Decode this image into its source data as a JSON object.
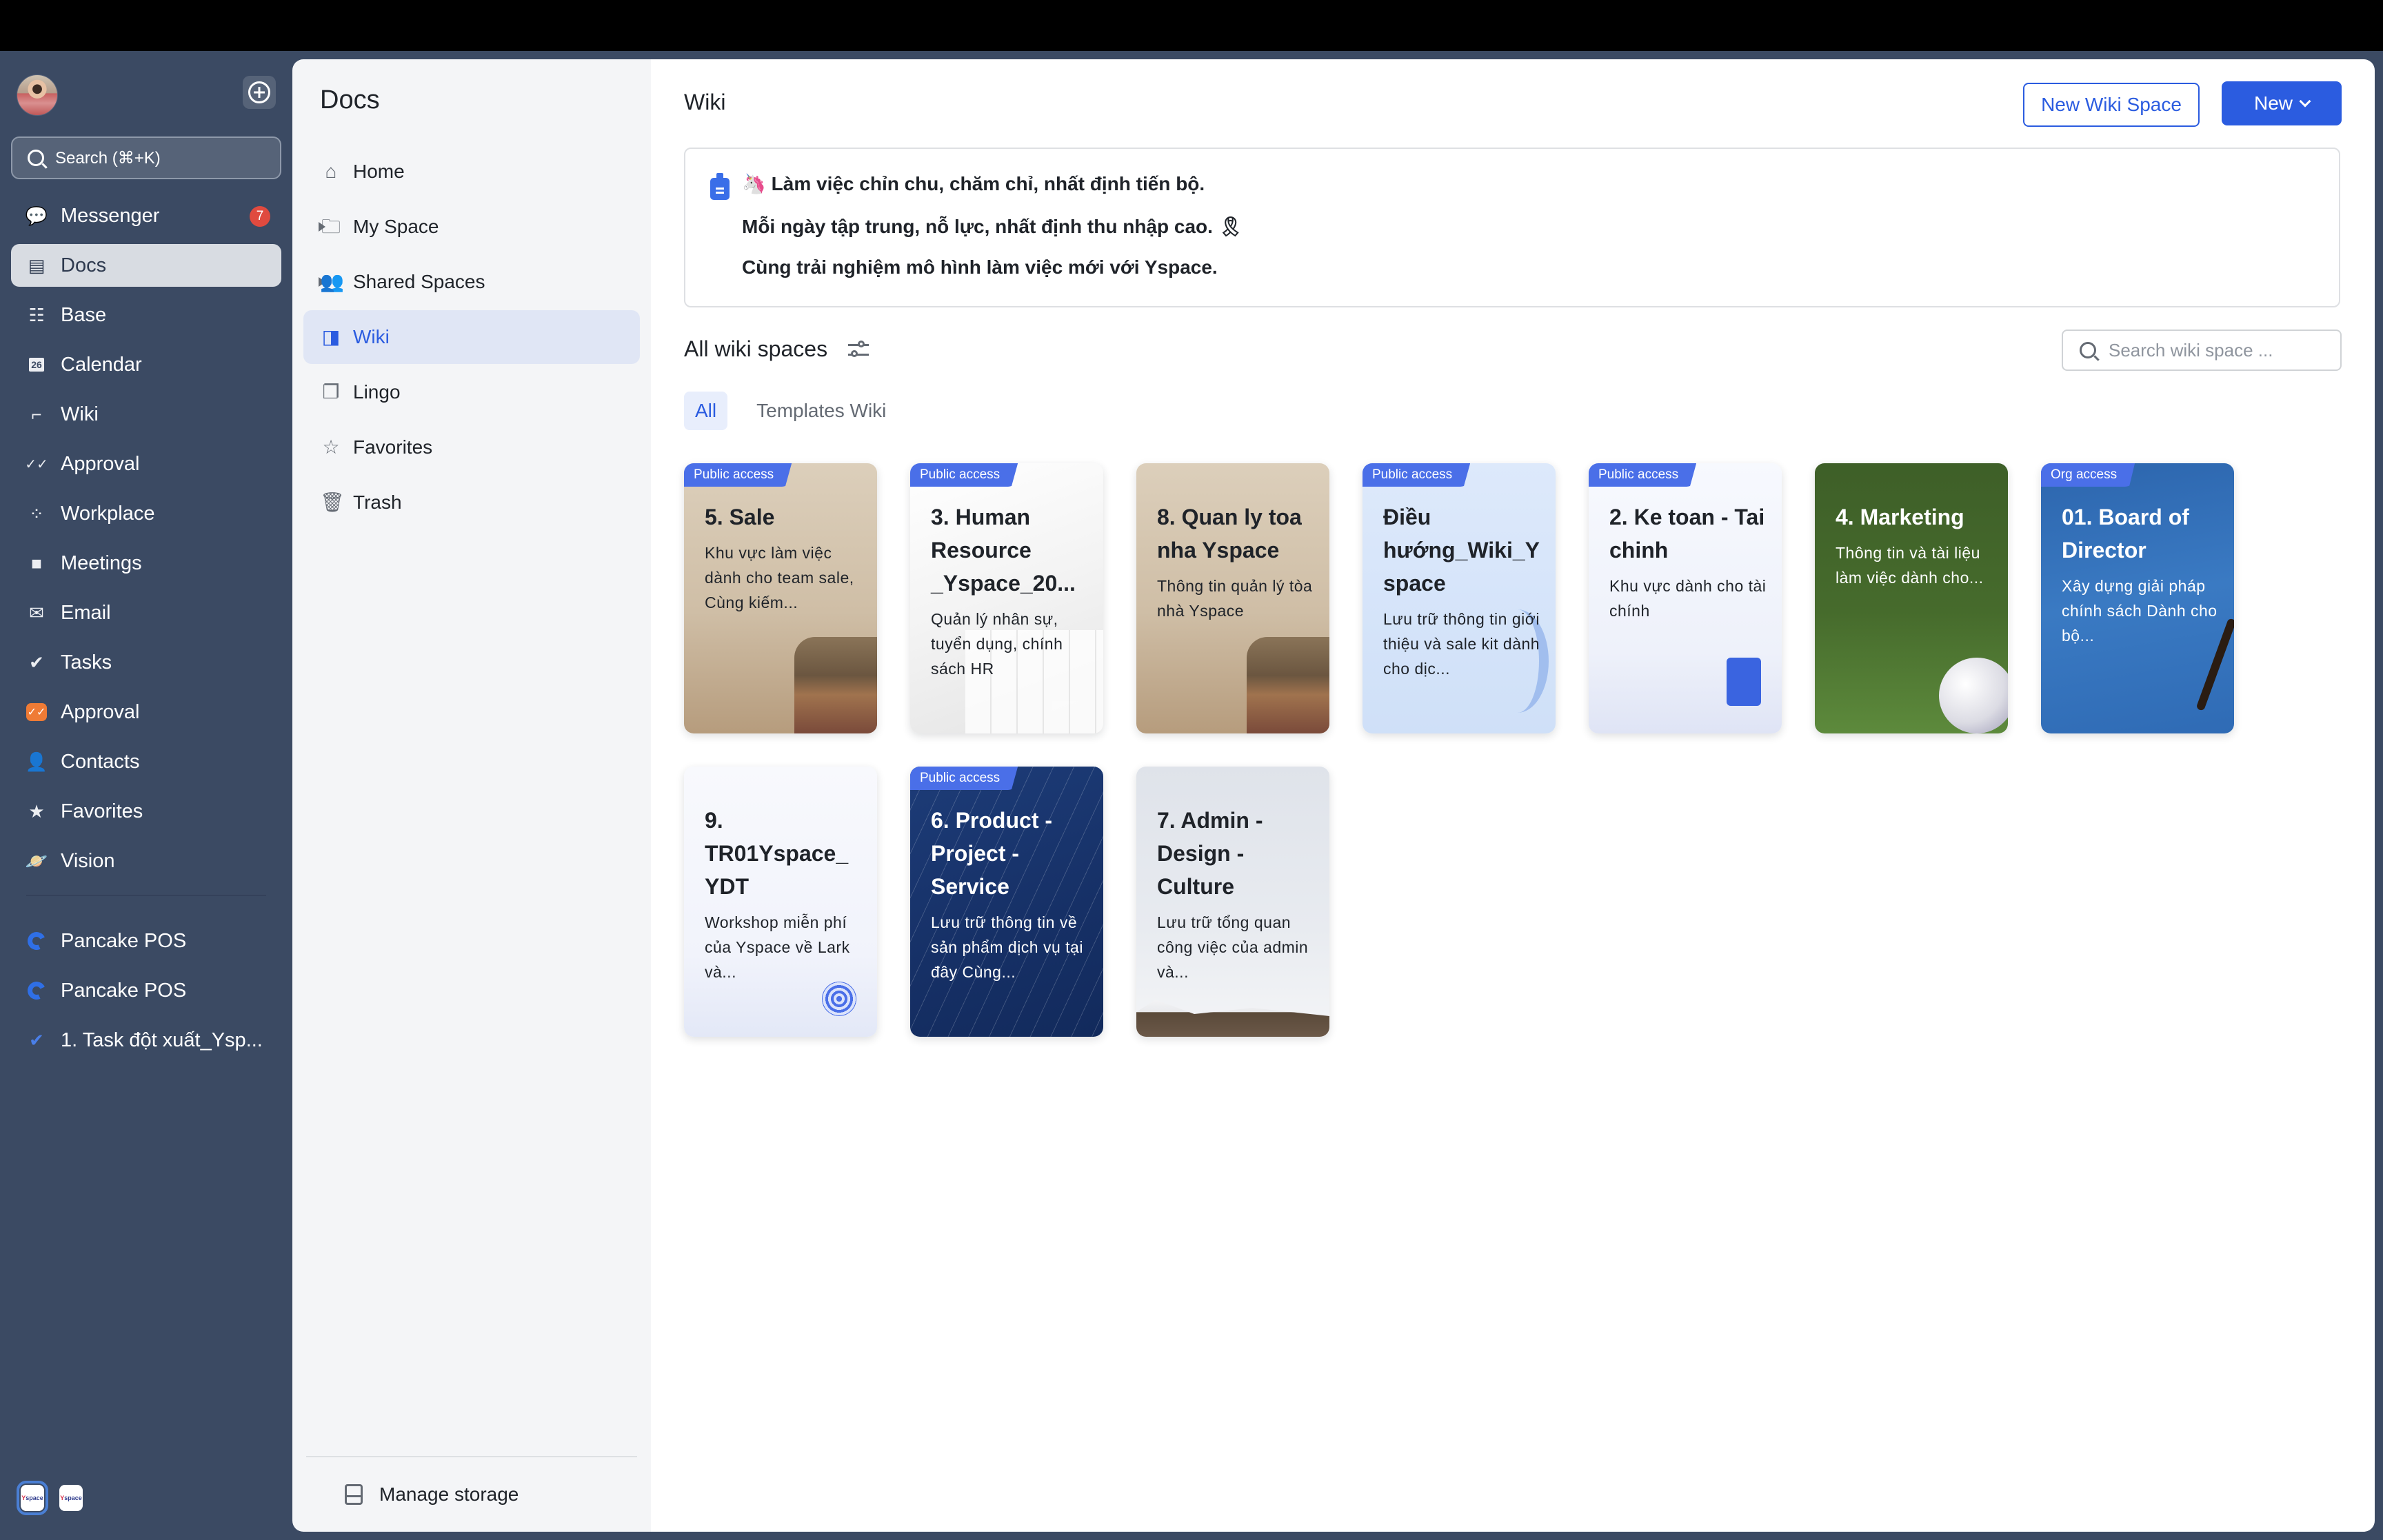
{
  "rail": {
    "search_label": "Search (⌘+K)",
    "items": [
      {
        "label": "Messenger",
        "icon": "messenger-icon",
        "badge": "7"
      },
      {
        "label": "Docs",
        "icon": "docs-icon",
        "active": true
      },
      {
        "label": "Base",
        "icon": "base-icon"
      },
      {
        "label": "Calendar",
        "icon": "calendar-icon"
      },
      {
        "label": "Wiki",
        "icon": "wiki-icon"
      },
      {
        "label": "Approval",
        "icon": "approval-icon"
      },
      {
        "label": "Workplace",
        "icon": "workplace-icon"
      },
      {
        "label": "Meetings",
        "icon": "meetings-icon"
      },
      {
        "label": "Email",
        "icon": "email-icon"
      },
      {
        "label": "Tasks",
        "icon": "tasks-icon"
      },
      {
        "label": "Approval",
        "icon": "approval-app-icon"
      },
      {
        "label": "Contacts",
        "icon": "contacts-icon"
      },
      {
        "label": "Favorites",
        "icon": "star-icon"
      },
      {
        "label": "Vision",
        "icon": "planet-icon"
      }
    ],
    "pinned": [
      {
        "label": "Pancake POS",
        "icon": "pancake-pos-icon"
      },
      {
        "label": "Pancake POS",
        "icon": "pancake-pos-icon"
      },
      {
        "label": "1. Task đột xuất_Ysp...",
        "icon": "task-list-icon"
      }
    ],
    "tenants": [
      {
        "label": "Yspace",
        "current": true
      },
      {
        "label": "Yspace",
        "current": false
      }
    ]
  },
  "docs_panel": {
    "title": "Docs",
    "items": [
      {
        "label": "Home",
        "icon": "home-icon",
        "expandable": false
      },
      {
        "label": "My Space",
        "icon": "folder-icon",
        "expandable": true
      },
      {
        "label": "Shared Spaces",
        "icon": "people-icon",
        "expandable": true
      },
      {
        "label": "Wiki",
        "icon": "wiki-icon",
        "expandable": false,
        "active": true
      },
      {
        "label": "Lingo",
        "icon": "lingo-icon",
        "expandable": false
      },
      {
        "label": "Favorites",
        "icon": "star-outline-icon",
        "expandable": false
      },
      {
        "label": "Trash",
        "icon": "trash-icon",
        "expandable": false
      }
    ],
    "manage_storage": "Manage storage"
  },
  "main": {
    "title": "Wiki",
    "new_wiki_space_label": "New Wiki Space",
    "new_label": "New",
    "announcement": {
      "line1": "🦄 Làm việc chỉn chu, chăm chỉ, nhất định tiến bộ.",
      "line2": "Mỗi ngày tập trung, nỗ lực, nhất định thu nhập cao. 🎗",
      "line3": "Cùng trải nghiệm mô hình làm việc mới với Yspace."
    },
    "section_title": "All wiki spaces",
    "search_placeholder": "Search wiki space ...",
    "tabs": [
      {
        "label": "All",
        "active": true
      },
      {
        "label": "Templates Wiki",
        "active": false
      }
    ],
    "cards": [
      {
        "badge": "Public access",
        "title": "5. Sale",
        "desc": "Khu vực làm việc dành cho team sale, Cùng kiếm...",
        "theme": "sale"
      },
      {
        "badge": "Public access",
        "title": "3. Human Resource _Yspace_20...",
        "desc": "Quản lý nhân sự, tuyển dụng, chính sách HR",
        "theme": "hr"
      },
      {
        "badge": "",
        "title": "8. Quan ly toa nha Yspace",
        "desc": "Thông tin quản lý tòa nhà Yspace",
        "theme": "sale"
      },
      {
        "badge": "Public access",
        "title": "Điều hướng_Wiki_Y space",
        "desc": "Lưu trữ thông tin giới thiệu và sale kit dành cho dịc...",
        "theme": "diem"
      },
      {
        "badge": "Public access",
        "title": "2. Ke toan - Tai chinh",
        "desc": "Khu vực dành cho tài chính",
        "theme": "ke"
      },
      {
        "badge": "",
        "title": "4. Marketing",
        "desc": "Thông tin và tài liệu làm việc dành cho...",
        "theme": "mkt"
      },
      {
        "badge": "Org access",
        "title": "01. Board of Director",
        "desc": "Xây dựng giải pháp chính sách Dành cho bộ...",
        "theme": "bod"
      },
      {
        "badge": "",
        "title": "9. TR01Yspace_ YDT",
        "desc": "Workshop miễn phí của Yspace về Lark và...",
        "theme": "tr"
      },
      {
        "badge": "Public access",
        "title": "6. Product - Project - Service",
        "desc": "Lưu trữ thông tin về sản phẩm dịch vụ tại đây Cùng...",
        "theme": "prod"
      },
      {
        "badge": "",
        "title": "7. Admin - Design - Culture",
        "desc": "Lưu trữ tổng quan công việc của admin và...",
        "theme": "admin"
      }
    ]
  },
  "colors": {
    "rail_bg": "#3b4a63",
    "accent": "#2b5ce0",
    "badge_red": "#e04a3f",
    "access_badge": "#4a6fe8"
  }
}
